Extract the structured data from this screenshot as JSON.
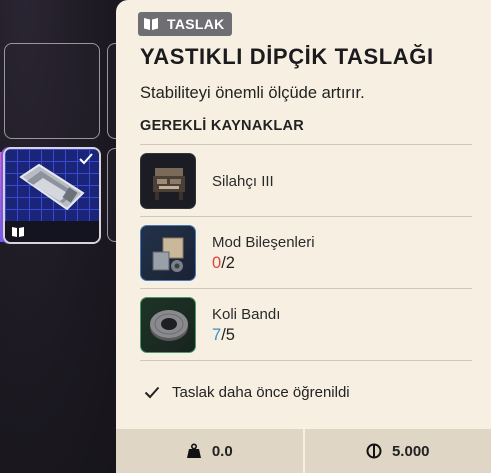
{
  "panel": {
    "badge_label": "TASLAK",
    "title": "YASTIKLI DİPÇİK TASLAĞI",
    "subtitle": "Stabiliteyi önemli ölçüde artırır.",
    "section_heading": "GEREKLİ KAYNAKLAR",
    "resources": [
      {
        "name": "Silahçı III",
        "icon": "workbench-icon"
      },
      {
        "name": "Mod Bileşenleri",
        "have": "0",
        "need": "/2",
        "icon": "mod-components-icon",
        "have_color": "#e0443a"
      },
      {
        "name": "Koli Bandı",
        "have": "7",
        "need": "/5",
        "icon": "duct-tape-icon",
        "have_color": "#3a8fc6"
      }
    ],
    "learned_text": "Taslak daha önce öğrenildi",
    "weight_value": "0.0",
    "price_value": "5.000"
  },
  "colors": {
    "panel_bg": "#f7f0e2",
    "badge_bg": "#6f6e72",
    "missing": "#e0443a",
    "sufficient": "#3a8fc6"
  }
}
